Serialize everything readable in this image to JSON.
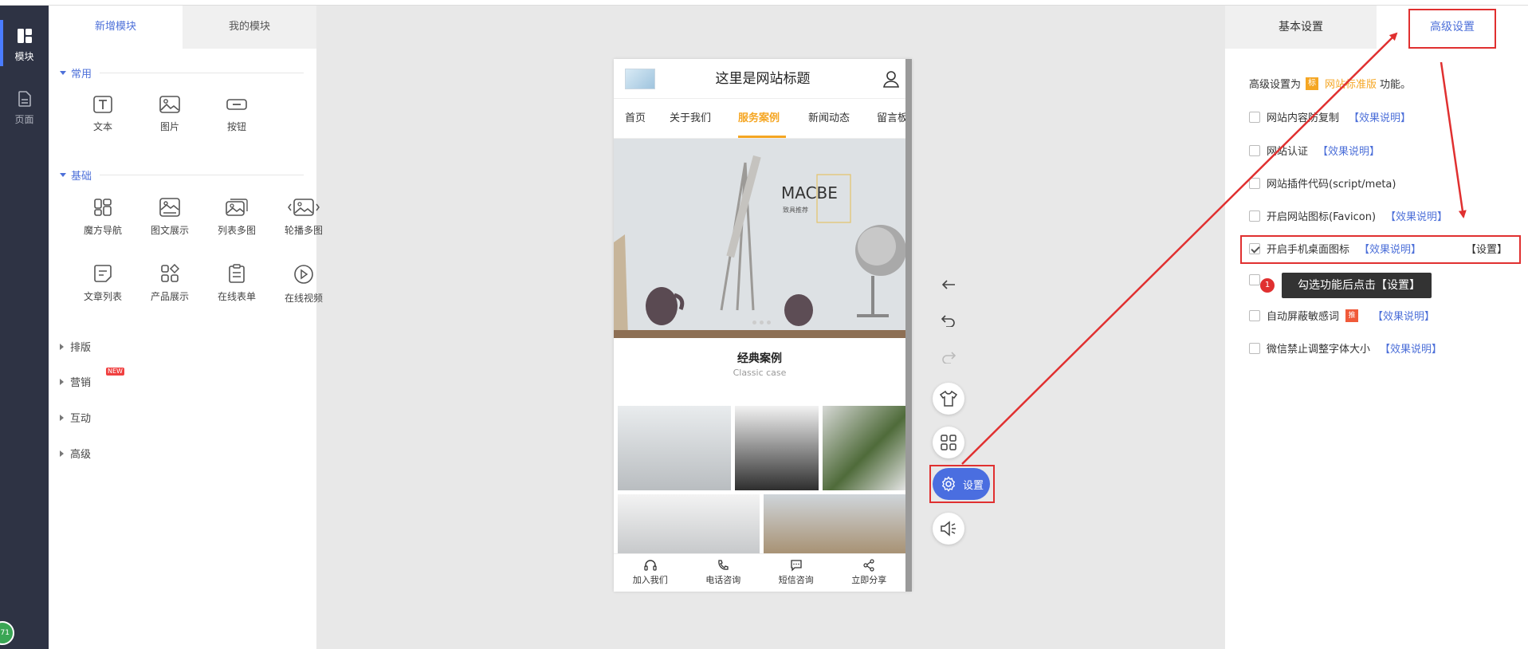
{
  "rail": {
    "items": [
      {
        "label": "模块",
        "icon": "layout-icon"
      },
      {
        "label": "页面",
        "icon": "page-icon"
      }
    ],
    "badge": "71"
  },
  "modules": {
    "tabs": [
      "新增模块",
      "我的模块"
    ],
    "sections": [
      {
        "title": "常用",
        "items": [
          {
            "label": "文本",
            "icon": "text-icon"
          },
          {
            "label": "图片",
            "icon": "image-icon"
          },
          {
            "label": "按钮",
            "icon": "button-icon"
          }
        ]
      },
      {
        "title": "基础",
        "items": [
          {
            "label": "魔方导航",
            "icon": "grid-nav-icon"
          },
          {
            "label": "图文展示",
            "icon": "image-text-icon"
          },
          {
            "label": "列表多图",
            "icon": "multi-image-icon"
          },
          {
            "label": "轮播多图",
            "icon": "carousel-icon"
          },
          {
            "label": "文章列表",
            "icon": "article-list-icon"
          },
          {
            "label": "产品展示",
            "icon": "product-icon"
          },
          {
            "label": "在线表单",
            "icon": "form-icon"
          },
          {
            "label": "在线视频",
            "icon": "video-icon"
          }
        ]
      }
    ],
    "collapsed": [
      {
        "label": "排版"
      },
      {
        "label": "营销",
        "badge": "NEW"
      },
      {
        "label": "互动"
      },
      {
        "label": "高级"
      }
    ]
  },
  "phone": {
    "site_title": "这里是网站标题",
    "nav": [
      "首页",
      "关于我们",
      "服务案例",
      "新闻动态",
      "留言板"
    ],
    "nav_selected": "服务案例",
    "banner_brand": "MACBE",
    "banner_brand_sub": "致具推荐",
    "section_title": "经典案例",
    "section_subtitle": "Classic case",
    "footer": [
      {
        "label": "加入我们",
        "icon": "headset-icon"
      },
      {
        "label": "电话咨询",
        "icon": "phone-icon"
      },
      {
        "label": "短信咨询",
        "icon": "message-icon"
      },
      {
        "label": "立即分享",
        "icon": "share-icon"
      }
    ]
  },
  "tools": {
    "settings_label": "设置"
  },
  "settings": {
    "tabs": [
      "基本设置",
      "高级设置"
    ],
    "intro_prefix": "高级设置为",
    "intro_badge": "标",
    "intro_standard": "网站标准版",
    "intro_suffix": "功能。",
    "link_text": "【效果说明】",
    "set_text": "【设置】",
    "tag_tui": "推",
    "options": [
      {
        "label": "网站内容防复制",
        "checked": false
      },
      {
        "label": "网站认证",
        "checked": false
      },
      {
        "label": "网站插件代码(script/meta)",
        "checked": false
      },
      {
        "label": "开启网站图标(Favicon)",
        "checked": false
      },
      {
        "label": "开启手机桌面图标",
        "checked": true
      },
      {
        "label": "",
        "checked": false
      },
      {
        "label": "自动屏蔽敏感词",
        "checked": false
      },
      {
        "label": "微信禁止调整字体大小",
        "checked": false
      }
    ],
    "tooltip": "勾选功能后点击【设置】",
    "tooltip_num": "1"
  },
  "colors": {
    "accent": "#4d70d9",
    "annotation": "#e03030",
    "highlight": "#f5a623"
  }
}
